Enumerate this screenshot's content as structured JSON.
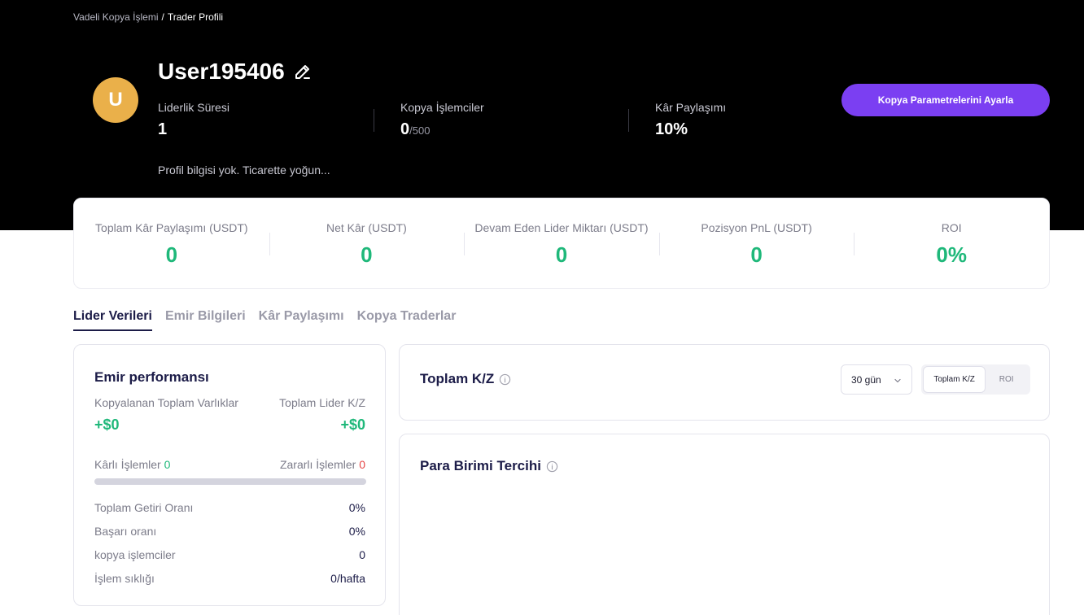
{
  "breadcrumb": {
    "parent": "Vadeli Kopya İşlemi",
    "separator": "/",
    "current": "Trader Profili"
  },
  "profile": {
    "avatar_letter": "U",
    "avatar_color": "#eab04a",
    "username": "User195406",
    "bio": "Profil bilgisi yok. Ticarette yoğun...",
    "stats": [
      {
        "label": "Liderlik Süresi",
        "value": "1",
        "suffix": ""
      },
      {
        "label": "Kopya İşlemciler",
        "value": "0",
        "suffix": "/500"
      },
      {
        "label": "Kâr Paylaşımı",
        "value": "10%",
        "suffix": ""
      }
    ],
    "copy_button": "Kopya Parametrelerini Ayarla"
  },
  "summary": [
    {
      "label": "Toplam Kâr Paylaşımı (USDT)",
      "value": "0"
    },
    {
      "label": "Net Kâr (USDT)",
      "value": "0"
    },
    {
      "label": "Devam Eden Lider Miktarı (USDT)",
      "value": "0"
    },
    {
      "label": "Pozisyon PnL (USDT)",
      "value": "0"
    },
    {
      "label": "ROI",
      "value": "0%"
    }
  ],
  "tabs": [
    {
      "label": "Lider Verileri",
      "active": true
    },
    {
      "label": "Emir Bilgileri",
      "active": false
    },
    {
      "label": "Kâr Paylaşımı",
      "active": false
    },
    {
      "label": "Kopya Traderlar",
      "active": false
    }
  ],
  "performance": {
    "title": "Emir performansı",
    "copied_assets_label": "Kopyalanan Toplam Varlıklar",
    "copied_assets_value": "+$0",
    "leader_pnl_label": "Toplam Lider K/Z",
    "leader_pnl_value": "+$0",
    "profitable_label": "Kârlı İşlemler",
    "profitable_value": "0",
    "losing_label": "Zararlı İşlemler",
    "losing_value": "0",
    "rows": [
      {
        "label": "Toplam Getiri Oranı",
        "value": "0%"
      },
      {
        "label": "Başarı oranı",
        "value": "0%"
      },
      {
        "label": "kopya işlemciler",
        "value": "0"
      },
      {
        "label": "İşlem sıklığı",
        "value": "0/hafta"
      }
    ]
  },
  "pnl_card": {
    "title": "Toplam K/Z",
    "period_select": "30 gün",
    "segments": [
      "Toplam K/Z",
      "ROI"
    ]
  },
  "currency_card": {
    "title": "Para Birimi Tercihi"
  },
  "colors": {
    "accent": "#7b3ff2",
    "positive": "#1fb87a",
    "negative": "#e64545",
    "heading": "#1c1c48"
  }
}
